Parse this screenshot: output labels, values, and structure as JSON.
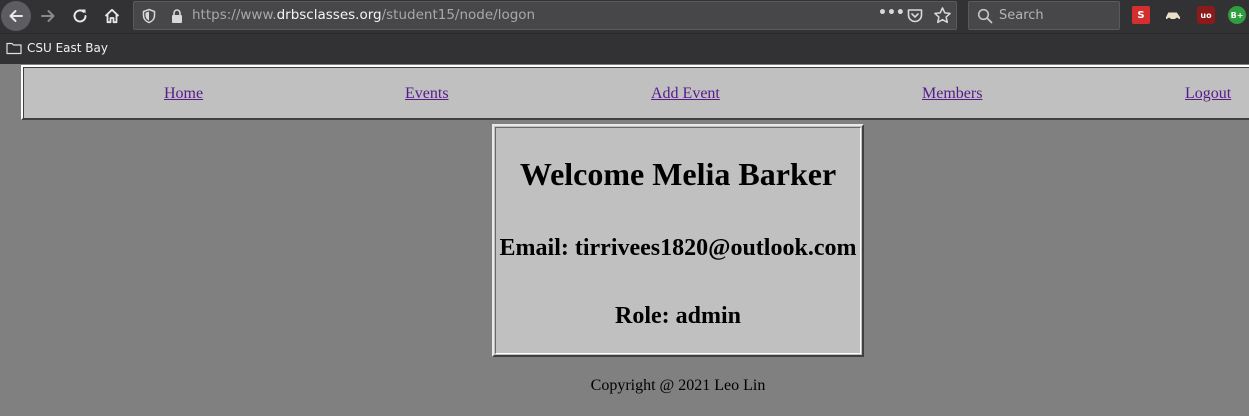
{
  "browser": {
    "url_prefix": "https://www.",
    "url_host": "drbsclasses.org",
    "url_path": "/student15/node/logon",
    "search_placeholder": "Search",
    "extensions": [
      "S",
      "",
      "uo",
      "B+"
    ],
    "bookmarks": [
      {
        "label": "CSU East Bay"
      }
    ]
  },
  "nav": {
    "links": [
      {
        "label": "Home"
      },
      {
        "label": "Events"
      },
      {
        "label": "Add Event"
      },
      {
        "label": "Members"
      },
      {
        "label": "Logout"
      }
    ],
    "link_color": "#551a8b",
    "bar_color": "#c0c0c0"
  },
  "welcome": {
    "title": "Welcome Melia Barker",
    "email": "Email: tirrivees1820@outlook.com",
    "role": "Role: admin"
  },
  "footer": {
    "copyright": "Copyright @ 2021 Leo Lin"
  },
  "colors": {
    "page_background": "#808080",
    "chrome_background": "#323234"
  }
}
